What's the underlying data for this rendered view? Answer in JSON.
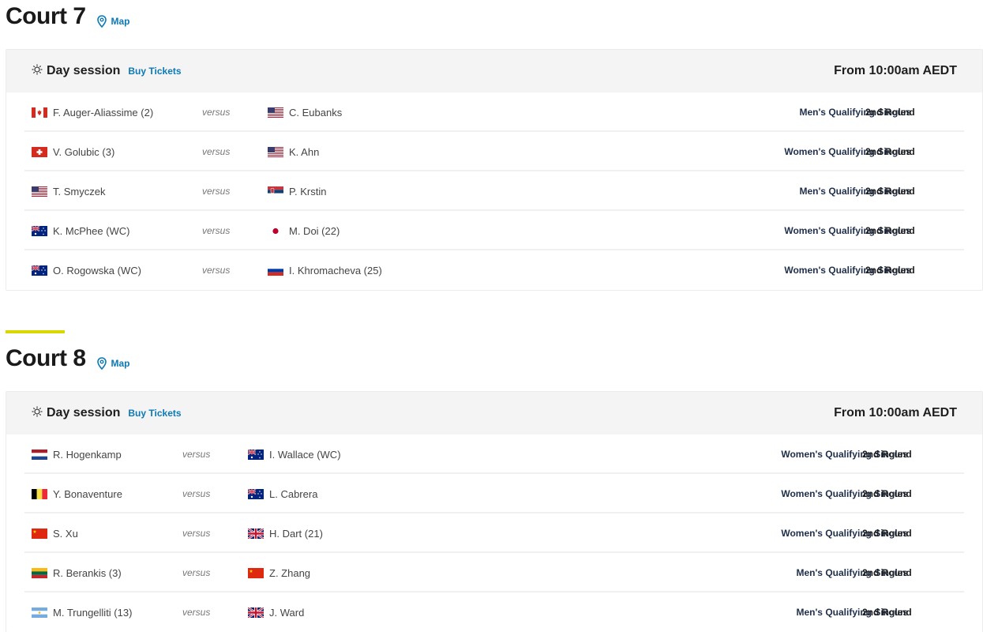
{
  "courts": [
    {
      "title": "Court 7",
      "map_label": "Map",
      "session": {
        "name": "Day session",
        "buy_label": "Buy Tickets",
        "time": "From 10:00am AEDT"
      },
      "matches": [
        {
          "p1": "F. Auger-Aliassime (2)",
          "p1_flag": "CAN",
          "versus": "versus",
          "p2": "C. Eubanks",
          "p2_flag": "USA",
          "event": "Men's Qualifying Singles",
          "round": "2nd Round"
        },
        {
          "p1": "V. Golubic (3)",
          "p1_flag": "SUI",
          "versus": "versus",
          "p2": "K. Ahn",
          "p2_flag": "USA",
          "event": "Women's Qualifying Singles",
          "round": "2nd Round"
        },
        {
          "p1": "T. Smyczek",
          "p1_flag": "USA",
          "versus": "versus",
          "p2": "P. Krstin",
          "p2_flag": "SRB",
          "event": "Men's Qualifying Singles",
          "round": "2nd Round"
        },
        {
          "p1": "K. McPhee (WC)",
          "p1_flag": "AUS",
          "versus": "versus",
          "p2": "M. Doi (22)",
          "p2_flag": "JPN",
          "event": "Women's Qualifying Singles",
          "round": "2nd Round"
        },
        {
          "p1": "O. Rogowska (WC)",
          "p1_flag": "AUS",
          "versus": "versus",
          "p2": "I. Khromacheva (25)",
          "p2_flag": "RUS",
          "event": "Women's Qualifying Singles",
          "round": "2nd Round"
        }
      ]
    },
    {
      "title": "Court 8",
      "map_label": "Map",
      "session": {
        "name": "Day session",
        "buy_label": "Buy Tickets",
        "time": "From 10:00am AEDT"
      },
      "matches": [
        {
          "p1": "R. Hogenkamp",
          "p1_flag": "NED",
          "versus": "versus",
          "p2": "I. Wallace (WC)",
          "p2_flag": "AUS",
          "event": "Women's Qualifying Singles",
          "round": "2nd Round"
        },
        {
          "p1": "Y. Bonaventure",
          "p1_flag": "BEL",
          "versus": "versus",
          "p2": "L. Cabrera",
          "p2_flag": "AUS",
          "event": "Women's Qualifying Singles",
          "round": "2nd Round"
        },
        {
          "p1": "S. Xu",
          "p1_flag": "CHN",
          "versus": "versus",
          "p2": "H. Dart (21)",
          "p2_flag": "GBR",
          "event": "Women's Qualifying Singles",
          "round": "2nd Round"
        },
        {
          "p1": "R. Berankis (3)",
          "p1_flag": "LTU",
          "versus": "versus",
          "p2": "Z. Zhang",
          "p2_flag": "CHN",
          "event": "Men's Qualifying Singles",
          "round": "2nd Round"
        },
        {
          "p1": "M. Trungelliti (13)",
          "p1_flag": "ARG",
          "versus": "versus",
          "p2": "J. Ward",
          "p2_flag": "GBR",
          "event": "Men's Qualifying Singles",
          "round": "2nd Round"
        }
      ]
    }
  ],
  "colors": {
    "link": "#0c79b5",
    "accent": "#d8d800",
    "event_text": "#1f2f4a",
    "session_bg": "#f4f4f4"
  }
}
